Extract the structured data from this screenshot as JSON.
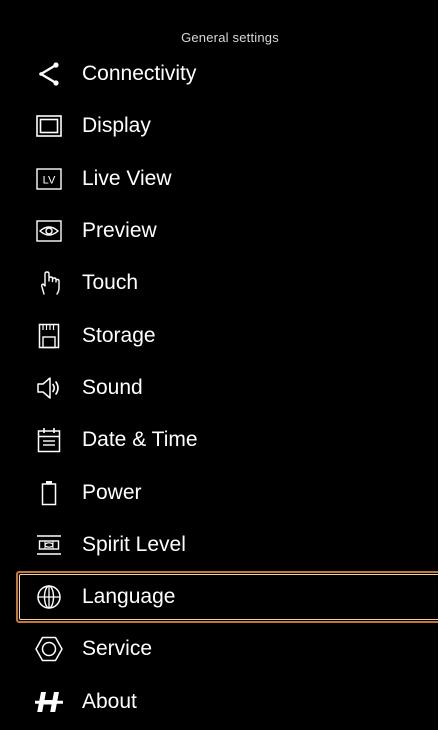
{
  "header": {
    "title": "General settings"
  },
  "accent_color": "#c4772e",
  "menu": {
    "items": [
      {
        "label": "Connectivity",
        "icon": "share-icon",
        "selected": false
      },
      {
        "label": "Display",
        "icon": "display-icon",
        "selected": false
      },
      {
        "label": "Live View",
        "icon": "live-view-icon",
        "selected": false
      },
      {
        "label": "Preview",
        "icon": "eye-icon",
        "selected": false
      },
      {
        "label": "Touch",
        "icon": "hand-touch-icon",
        "selected": false
      },
      {
        "label": "Storage",
        "icon": "memory-card-icon",
        "selected": false
      },
      {
        "label": "Sound",
        "icon": "speaker-icon",
        "selected": false
      },
      {
        "label": "Date & Time",
        "icon": "calendar-icon",
        "selected": false
      },
      {
        "label": "Power",
        "icon": "battery-icon",
        "selected": false
      },
      {
        "label": "Spirit Level",
        "icon": "spirit-level-icon",
        "selected": false
      },
      {
        "label": "Language",
        "icon": "globe-icon",
        "selected": true
      },
      {
        "label": "Service",
        "icon": "hexagon-icon",
        "selected": false
      },
      {
        "label": "About",
        "icon": "h-logo-icon",
        "selected": false
      }
    ]
  }
}
